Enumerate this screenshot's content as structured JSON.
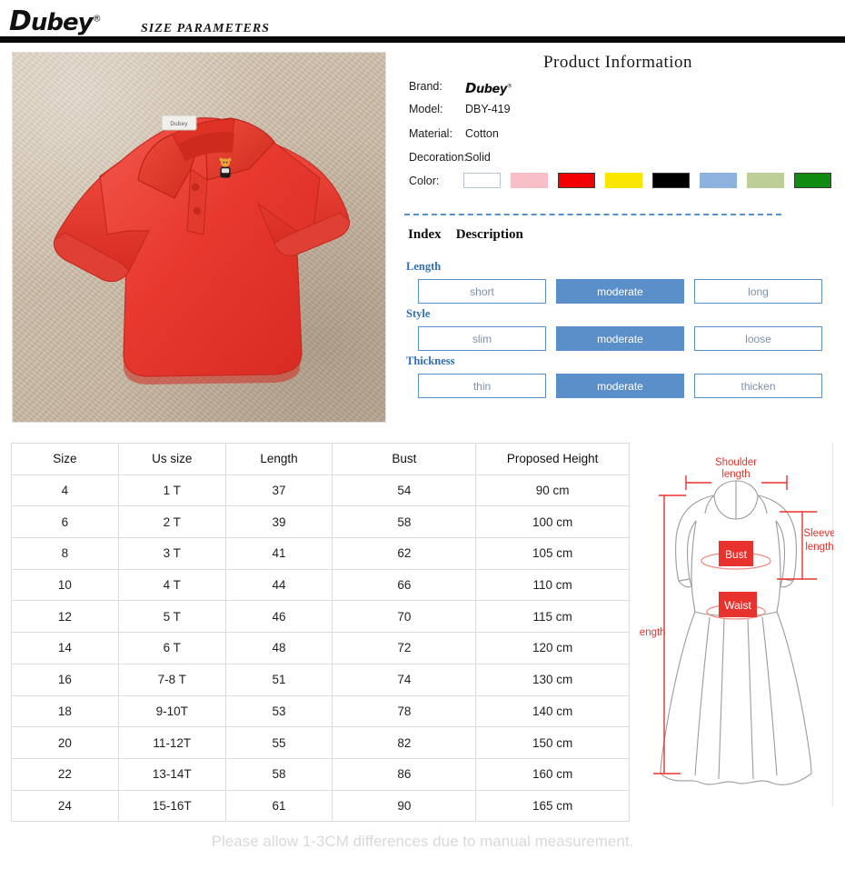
{
  "header": {
    "logo_d": "D",
    "logo_rest": "ubey",
    "logo_reg": "®",
    "title": "SIZE  PARAMETERS"
  },
  "product_photo": {
    "alt": "red kids polo shirt on beige carpet",
    "shirt_color": "#e8392f",
    "background_color": "#cdbfae"
  },
  "product_info": {
    "title": "Product  Information",
    "labels": {
      "brand": "Brand:",
      "model": "Model:",
      "material": "Material:",
      "decoration": "Decoration:",
      "color": "Color:"
    },
    "values": {
      "brand_logo_d": "D",
      "brand_logo_rest": "ubey",
      "brand_logo_reg": "®",
      "model": "DBY-419",
      "material": "Cotton",
      "decoration": "Solid"
    },
    "colors": [
      {
        "name": "white",
        "hex": "#ffffff",
        "border": "#b9c4d4"
      },
      {
        "name": "pink",
        "hex": "#f9bfc9",
        "border": "#f9bfc9"
      },
      {
        "name": "red",
        "hex": "#f20000",
        "border": "#3a3a3a"
      },
      {
        "name": "yellow",
        "hex": "#fbe600",
        "border": "#fbe600"
      },
      {
        "name": "black",
        "hex": "#000000",
        "border": "#3a3a3a"
      },
      {
        "name": "light-blue",
        "hex": "#8db2dd",
        "border": "#8db2dd"
      },
      {
        "name": "light-green",
        "hex": "#bdcf96",
        "border": "#bdcf96"
      },
      {
        "name": "dark-green",
        "hex": "#0f8b12",
        "border": "#3a3a3a"
      }
    ]
  },
  "index_section": {
    "heading_index": "Index",
    "heading_description": "Description",
    "accent_color": "#5b8fc9",
    "groups": [
      {
        "label": "Length",
        "options": [
          "short",
          "moderate",
          "long"
        ],
        "selected": 1
      },
      {
        "label": "Style",
        "options": [
          "slim",
          "moderate",
          "loose"
        ],
        "selected": 1
      },
      {
        "label": "Thickness",
        "options": [
          "thin",
          "moderate",
          "thicken"
        ],
        "selected": 1
      }
    ]
  },
  "size_table": {
    "columns": [
      "Size",
      "Us size",
      "Length",
      "Bust",
      "Proposed Height"
    ],
    "rows": [
      [
        "4",
        "1 T",
        "37",
        "54",
        "90 cm"
      ],
      [
        "6",
        "2 T",
        "39",
        "58",
        "100 cm"
      ],
      [
        "8",
        "3 T",
        "41",
        "62",
        "105 cm"
      ],
      [
        "10",
        "4 T",
        "44",
        "66",
        "110 cm"
      ],
      [
        "12",
        "5 T",
        "46",
        "70",
        "115 cm"
      ],
      [
        "14",
        "6 T",
        "48",
        "72",
        "120 cm"
      ],
      [
        "16",
        "7-8 T",
        "51",
        "74",
        "130 cm"
      ],
      [
        "18",
        "9-10T",
        "53",
        "78",
        "140 cm"
      ],
      [
        "20",
        "11-12T",
        "55",
        "82",
        "150 cm"
      ],
      [
        "22",
        "13-14T",
        "58",
        "86",
        "160 cm"
      ],
      [
        "24",
        "15-16T",
        "61",
        "90",
        "165 cm"
      ]
    ]
  },
  "diagram": {
    "labels": {
      "shoulder_line1": "Shoulder",
      "shoulder_line2": "length",
      "sleeve_line1": "Sleeve",
      "sleeve_line2": "length",
      "bust": "Bust",
      "waist": "Waist",
      "length": "Length"
    },
    "accent_color": "#e8322d"
  },
  "footer": {
    "note": "Please allow 1-3CM differences due to manual measurement."
  }
}
